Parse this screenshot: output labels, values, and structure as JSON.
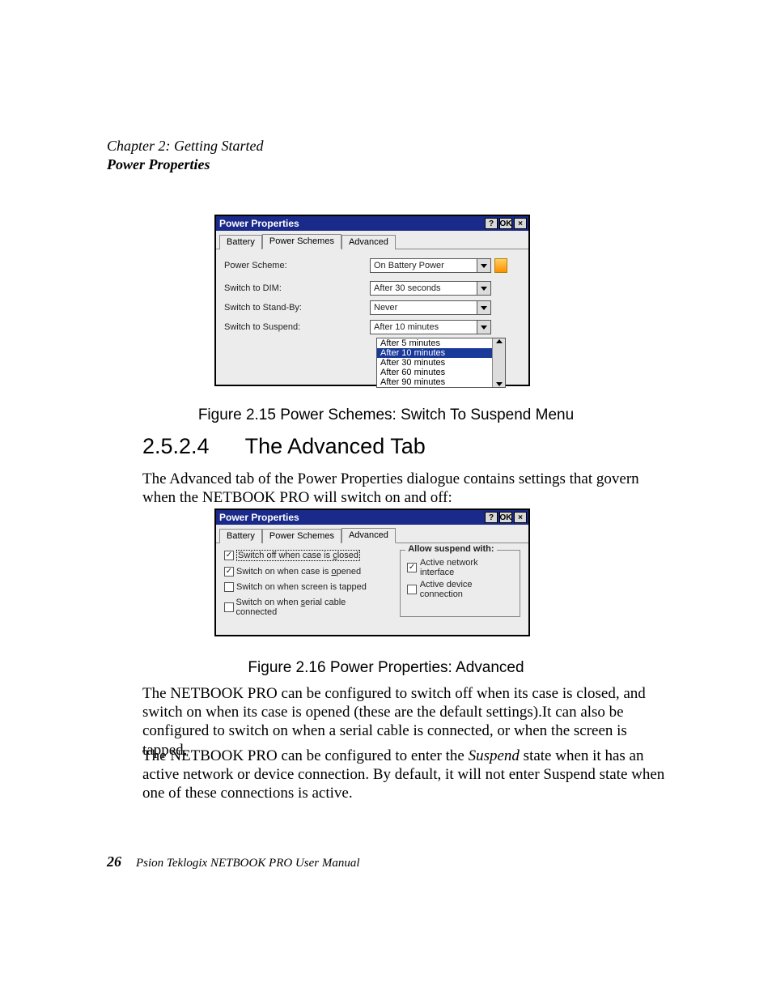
{
  "header": {
    "chapter": "Chapter 2:  Getting Started",
    "section": "Power Properties"
  },
  "dialog1": {
    "title": "Power Properties",
    "buttons": {
      "help": "?",
      "ok": "OK",
      "close": "×"
    },
    "tabs": [
      "Battery",
      "Power Schemes",
      "Advanced"
    ],
    "active_tab_index": 1,
    "fields": {
      "scheme_label": "Power Scheme:",
      "scheme_value": "On Battery Power",
      "dim_label": "Switch to DIM:",
      "dim_value": "After 30 seconds",
      "standby_label": "Switch to Stand-By:",
      "standby_value": "Never",
      "suspend_label": "Switch to Suspend:",
      "suspend_value": "After 10 minutes"
    },
    "suspend_menu": [
      "After 5 minutes",
      "After 10 minutes",
      "After 30 minutes",
      "After 60 minutes",
      "After 90 minutes"
    ],
    "suspend_selected_index": 1
  },
  "caption1": "Figure 2.15 Power Schemes: Switch To Suspend Menu",
  "heading": {
    "number": "2.5.2.4",
    "text": "The Advanced Tab"
  },
  "para1": "The Advanced tab of the Power Properties dialogue contains settings that govern when the NETBOOK PRO will switch on and off:",
  "dialog2": {
    "title": "Power Properties",
    "buttons": {
      "help": "?",
      "ok": "OK",
      "close": "×"
    },
    "tabs": [
      "Battery",
      "Power Schemes",
      "Advanced"
    ],
    "active_tab_index": 2,
    "checks": {
      "c1_label_pre": "Switch off when case is ",
      "c1_label_u": "c",
      "c1_label_post": "losed",
      "c1_checked": true,
      "c2_label_pre": "Switch on when case is ",
      "c2_label_u": "o",
      "c2_label_post": "pened",
      "c2_checked": true,
      "c3_label": "Switch on when screen is tapped",
      "c3_checked": false,
      "c4_label_pre": "Switch on when ",
      "c4_label_u": "s",
      "c4_label_post": "erial cable connected",
      "c4_checked": false
    },
    "fieldset": {
      "legend": "Allow suspend with:",
      "i1_label": "Active network interface",
      "i1_checked": true,
      "i2_label": "Active device connection",
      "i2_checked": false
    }
  },
  "caption2": "Figure 2.16 Power Properties: Advanced",
  "para2": "The NETBOOK PRO can be configured to switch off when its case is closed, and switch on when its case is opened (these are the default settings).It can also be configured to switch on when a serial cable is connected, or when the screen is tapped.",
  "para3_a": "The NETBOOK PRO can be configured to enter the ",
  "para3_b": "Suspend",
  "para3_c": " state when it has an active network or device connection. By default, it will not enter Suspend state when one of these connections is active.",
  "footer": {
    "page": "26",
    "text": "Psion Teklogix NETBOOK PRO User Manual"
  }
}
